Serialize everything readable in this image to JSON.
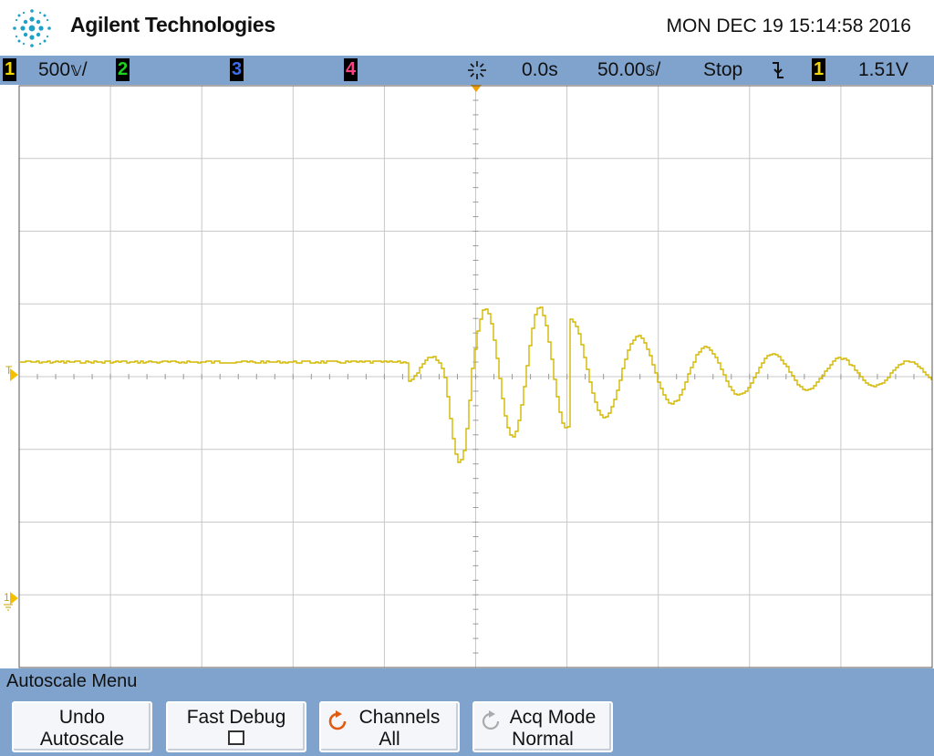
{
  "header": {
    "brand": "Agilent Technologies",
    "datetime": "MON DEC 19 15:14:58 2016"
  },
  "status": {
    "ch1": {
      "num": "1",
      "scale": "500𝕧/",
      "color": "#f2d700"
    },
    "ch2": {
      "num": "2",
      "color": "#1fd11f"
    },
    "ch3": {
      "num": "3",
      "color": "#3b6ff0"
    },
    "ch4": {
      "num": "4",
      "color": "#ff3f7f"
    },
    "time_ref": "0.0s",
    "timebase": "50.00𝕤/",
    "run_state": "Stop",
    "trigger_slope_icon": "falling-edge-icon",
    "trigger_source": "1",
    "trigger_level": "1.51V"
  },
  "screen": {
    "trigger_marker": "T",
    "ground_marker": "1"
  },
  "menu": {
    "title": "Autoscale Menu",
    "keys": [
      {
        "l1": "Undo",
        "l2": "Autoscale"
      },
      {
        "l1": "Fast Debug",
        "checked": false
      },
      {
        "l1": "Channels",
        "l2": "All",
        "icon": "cycle-icon"
      },
      {
        "l1": "Acq Mode",
        "l2": "Normal",
        "icon": "cycle-icon"
      }
    ]
  },
  "colors": {
    "trace": "#d4b800",
    "grid": "#c8c8c8",
    "bar": "#7fa3cd"
  }
}
